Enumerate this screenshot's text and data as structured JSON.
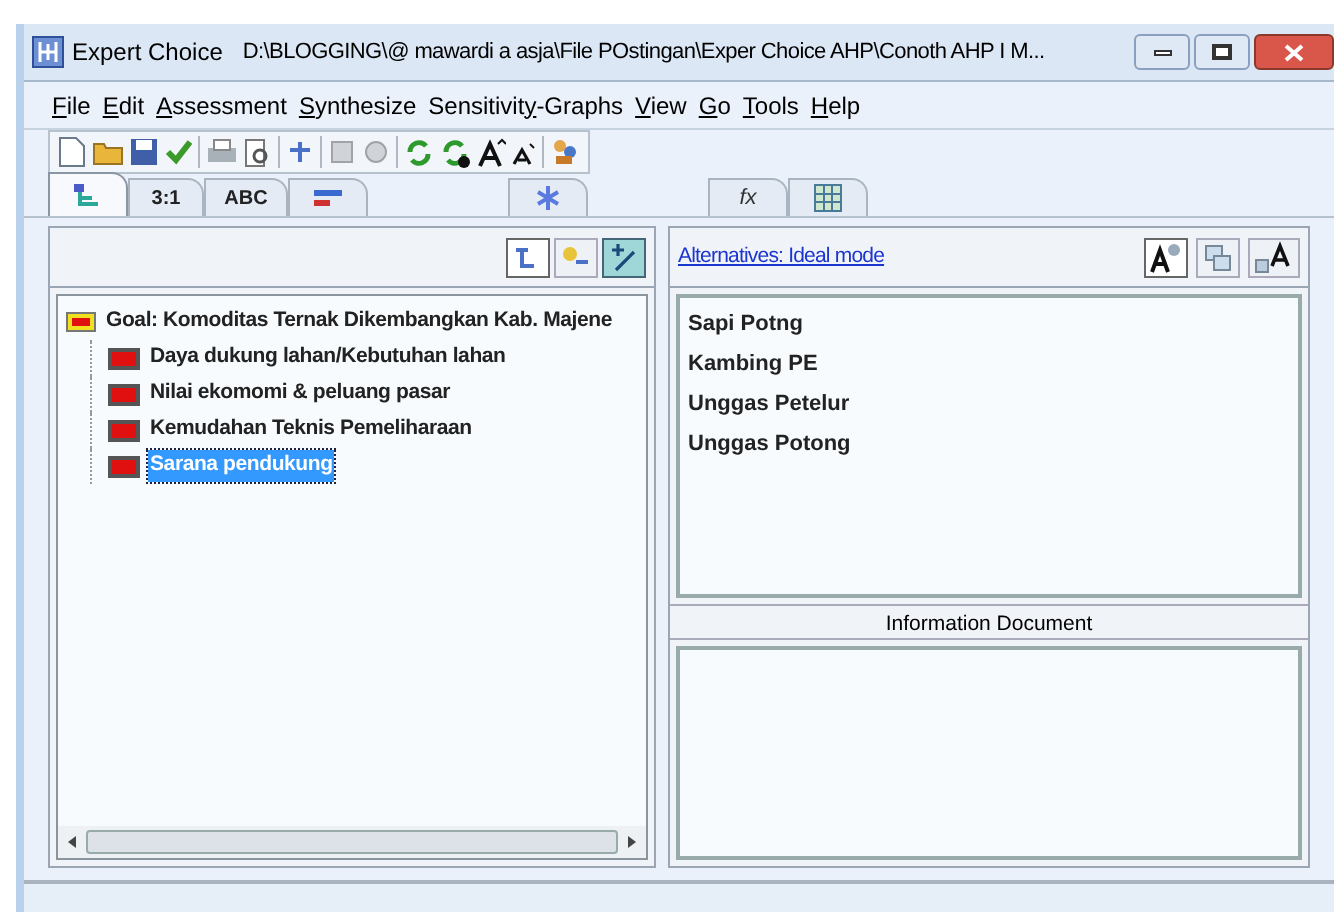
{
  "window": {
    "title": "Expert Choice",
    "path": "D:\\BLOGGING\\@ mawardi a asja\\File POstingan\\Exper Choice AHP\\Conoth AHP I M..."
  },
  "menu": [
    {
      "key": "F",
      "after": "ile"
    },
    {
      "key": "E",
      "after": "dit"
    },
    {
      "key": "A",
      "after": "ssessment"
    },
    {
      "key": "S",
      "after": "ynthesize"
    },
    {
      "before": "Sensitivit",
      "key": "y",
      "after": "-Graphs"
    },
    {
      "key": "V",
      "after": "iew"
    },
    {
      "key": "G",
      "after": "o"
    },
    {
      "key": "T",
      "after": "ools"
    },
    {
      "key": "H",
      "after": "elp"
    }
  ],
  "tabs": [
    {
      "kind": "tree",
      "selected": true
    },
    {
      "kind": "text",
      "label": "3:1",
      "selected": false
    },
    {
      "kind": "text",
      "label": "ABC",
      "selected": false
    },
    {
      "kind": "bars",
      "selected": false
    },
    {
      "kind": "sparkle",
      "selected": false
    },
    {
      "kind": "text",
      "label": "fx",
      "selected": false
    },
    {
      "kind": "grid",
      "selected": false
    }
  ],
  "tree": {
    "label": "Goal: Komoditas Ternak Dikembangkan Kab. Majene",
    "selected": false,
    "children": [
      {
        "label": "Daya dukung lahan/Kebutuhan lahan",
        "selected": false
      },
      {
        "label": "Nilai ekomomi & peluang pasar",
        "selected": false
      },
      {
        "label": "Kemudahan Teknis Pemeliharaan",
        "selected": false
      },
      {
        "label": "Sarana pendukung",
        "selected": true
      }
    ]
  },
  "alternatives": {
    "mode_link": "Alternatives: Ideal mode",
    "items": [
      "Sapi Potng",
      "Kambing PE",
      "Unggas Petelur",
      "Unggas Potong"
    ]
  },
  "info_panel": {
    "title": "Information Document"
  }
}
